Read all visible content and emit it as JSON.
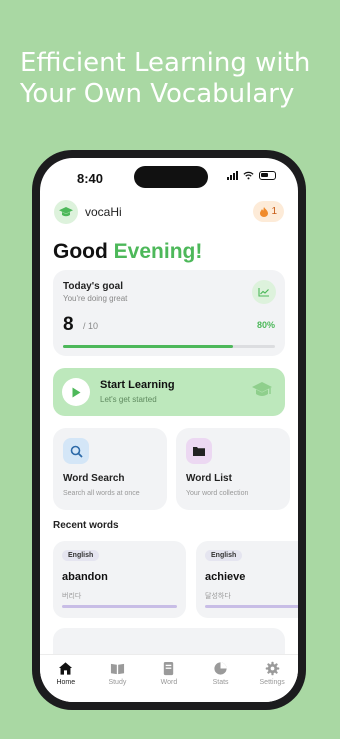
{
  "promo": {
    "line1": "Efficient Learning with",
    "line2": "Your Own Vocabulary"
  },
  "status": {
    "time": "8:40"
  },
  "app": {
    "name": "vocaHi",
    "streak_count": "1"
  },
  "greeting": {
    "prefix": "Good",
    "highlight": "Evening!"
  },
  "goal": {
    "title": "Today's goal",
    "subtitle": "You're doing great",
    "done": "8",
    "total": "/ 10",
    "percent_label": "80%",
    "progress": 0.8
  },
  "start": {
    "title": "Start Learning",
    "subtitle": "Let's get started"
  },
  "cards": [
    {
      "title": "Word Search",
      "subtitle": "Search all words at once",
      "icon": "search-icon"
    },
    {
      "title": "Word List",
      "subtitle": "Your word collection",
      "icon": "folder-icon"
    }
  ],
  "recent": {
    "heading": "Recent words",
    "items": [
      {
        "lang": "English",
        "word": "abandon",
        "meaning": "버리다"
      },
      {
        "lang": "English",
        "word": "achieve",
        "meaning": "달성하다"
      }
    ]
  },
  "tabs": [
    {
      "label": "Home",
      "icon": "home-icon",
      "active": true
    },
    {
      "label": "Study",
      "icon": "book-icon",
      "active": false
    },
    {
      "label": "Word",
      "icon": "card-icon",
      "active": false
    },
    {
      "label": "Stats",
      "icon": "pie-chart-icon",
      "active": false
    },
    {
      "label": "Settings",
      "icon": "gear-icon",
      "active": false
    }
  ],
  "colors": {
    "background": "#a9d8a3",
    "accent": "#4db85a",
    "start_card": "#bde8bc"
  }
}
